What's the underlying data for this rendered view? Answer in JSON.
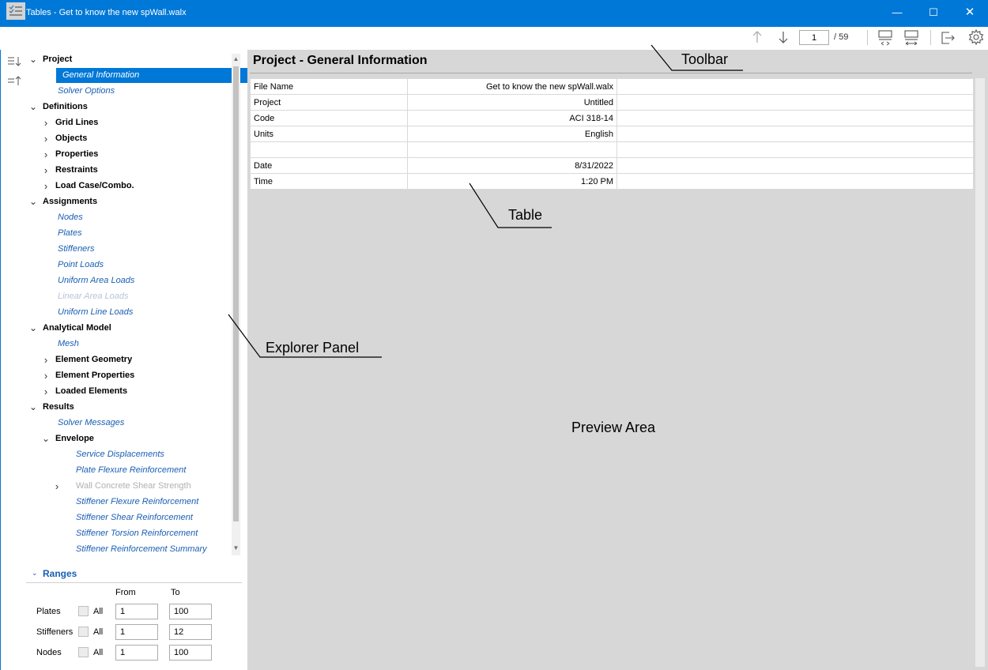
{
  "window": {
    "logo": "sp",
    "title": "Tables - Get to know the new spWall.walx"
  },
  "toolbar": {
    "page_current": "1",
    "page_total": "/ 59",
    "icons": [
      "list-view-icon",
      "arrow-up-icon",
      "arrow-down-icon",
      "collapse-rows-icon",
      "expand-rows-icon",
      "export-icon",
      "settings-gear-icon"
    ]
  },
  "explorer": {
    "tree": [
      {
        "label": "Project",
        "style": "bold",
        "level": 0,
        "arrow": "expanded"
      },
      {
        "label": "General Information",
        "style": "link",
        "level": 1,
        "selected": true
      },
      {
        "label": "Solver Options",
        "style": "link",
        "level": 1
      },
      {
        "label": "Definitions",
        "style": "bold",
        "level": 0,
        "arrow": "expanded"
      },
      {
        "label": "Grid Lines",
        "style": "bold",
        "level": 1,
        "arrow": "collapsed"
      },
      {
        "label": "Objects",
        "style": "bold",
        "level": 1,
        "arrow": "collapsed"
      },
      {
        "label": "Properties",
        "style": "bold",
        "level": 1,
        "arrow": "collapsed"
      },
      {
        "label": "Restraints",
        "style": "bold",
        "level": 1,
        "arrow": "collapsed"
      },
      {
        "label": "Load Case/Combo.",
        "style": "bold",
        "level": 1,
        "arrow": "collapsed"
      },
      {
        "label": "Assignments",
        "style": "bold",
        "level": 0,
        "arrow": "expanded"
      },
      {
        "label": "Nodes",
        "style": "link",
        "level": 1
      },
      {
        "label": "Plates",
        "style": "link",
        "level": 1
      },
      {
        "label": "Stiffeners",
        "style": "link",
        "level": 1
      },
      {
        "label": "Point Loads",
        "style": "link",
        "level": 1
      },
      {
        "label": "Uniform Area Loads",
        "style": "link",
        "level": 1
      },
      {
        "label": "Linear Area Loads",
        "style": "disabled",
        "level": 1
      },
      {
        "label": "Uniform Line Loads",
        "style": "link",
        "level": 1
      },
      {
        "label": "Analytical Model",
        "style": "bold",
        "level": 0,
        "arrow": "expanded"
      },
      {
        "label": "Mesh",
        "style": "link",
        "level": 1
      },
      {
        "label": "Element Geometry",
        "style": "bold",
        "level": 1,
        "arrow": "collapsed"
      },
      {
        "label": "Element Properties",
        "style": "bold",
        "level": 1,
        "arrow": "collapsed"
      },
      {
        "label": "Loaded Elements",
        "style": "bold",
        "level": 1,
        "arrow": "collapsed"
      },
      {
        "label": "Results",
        "style": "bold",
        "level": 0,
        "arrow": "expanded"
      },
      {
        "label": "Solver Messages",
        "style": "link",
        "level": 1
      },
      {
        "label": "Envelope",
        "style": "bold",
        "level": 1,
        "arrow": "expanded"
      },
      {
        "label": "Service Displacements",
        "style": "link",
        "level": 2
      },
      {
        "label": "Plate Flexure Reinforcement",
        "style": "link",
        "level": 2
      },
      {
        "label": "Wall Concrete Shear Strength",
        "style": "disabled-plain",
        "level": 2,
        "arrow": "collapsed"
      },
      {
        "label": "Stiffener Flexure Reinforcement",
        "style": "link",
        "level": 2
      },
      {
        "label": "Stiffener Shear Reinforcement",
        "style": "link",
        "level": 2
      },
      {
        "label": "Stiffener Torsion Reinforcement",
        "style": "link",
        "level": 2
      },
      {
        "label": "Stiffener Reinforcement Summary",
        "style": "link",
        "level": 2
      }
    ]
  },
  "ranges": {
    "header": "Ranges",
    "col_from": "From",
    "col_to": "To",
    "all_label": "All",
    "rows": [
      {
        "label": "Plates",
        "from": "1",
        "to": "100"
      },
      {
        "label": "Stiffeners",
        "from": "1",
        "to": "12"
      },
      {
        "label": "Nodes",
        "from": "1",
        "to": "100"
      }
    ]
  },
  "preview": {
    "title": "Project - General Information",
    "table": [
      [
        "File Name",
        "Get to know the new spWall.walx",
        ""
      ],
      [
        "Project",
        "Untitled",
        ""
      ],
      [
        "Code",
        "ACI 318-14",
        ""
      ],
      [
        "Units",
        "English",
        ""
      ],
      [
        "",
        "",
        ""
      ],
      [
        "Date",
        "8/31/2022",
        ""
      ],
      [
        "Time",
        "1:20 PM",
        ""
      ]
    ]
  },
  "annotations": {
    "toolbar": "Toolbar",
    "table": "Table",
    "explorer": "Explorer Panel",
    "preview": "Preview Area"
  },
  "colors": {
    "titlebar": "#0078d7",
    "link": "#1a5fb4",
    "selected": "#0078d7",
    "preview_bg": "#d7d7d7"
  }
}
